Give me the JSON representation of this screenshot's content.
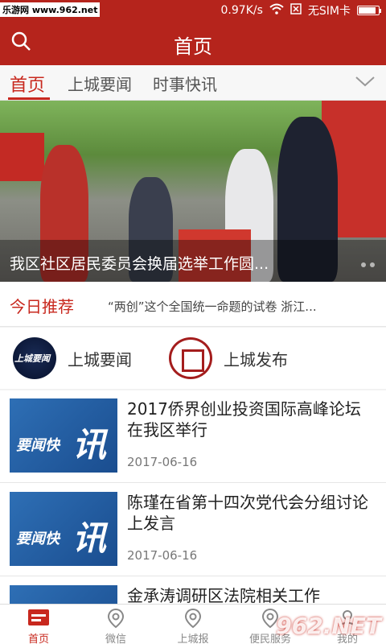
{
  "status_bar": {
    "watermark": "乐游网 www.962.net",
    "speed": "0.97K/s",
    "sim": "无SIM卡"
  },
  "app_bar": {
    "title": "首页"
  },
  "tabs": [
    {
      "label": "首页"
    },
    {
      "label": "上城要闻"
    },
    {
      "label": "时事快讯"
    }
  ],
  "banner": {
    "caption": "我区社区居民委员会换届选举工作圆..."
  },
  "recommend": {
    "label": "今日推荐",
    "text": "“两创”这个全国统一命题的试卷 浙江..."
  },
  "channels": [
    {
      "name": "上城要闻",
      "logo_text": "上城要闻"
    },
    {
      "name": "上城发布"
    }
  ],
  "news": [
    {
      "headline": "2017侨界创业投资国际高峰论坛在我区举行",
      "date": "2017-06-16",
      "thumb_text1": "要闻快",
      "thumb_text2": "讯"
    },
    {
      "headline": "陈瑾在省第十四次党代会分组讨论上发言",
      "date": "2017-06-16",
      "thumb_text1": "要闻快",
      "thumb_text2": "讯"
    },
    {
      "headline": "金承涛调研区法院相关工作",
      "date": "",
      "thumb_text1": "",
      "thumb_text2": ""
    }
  ],
  "bottom_nav": [
    {
      "label": "首页",
      "icon": "home-icon"
    },
    {
      "label": "微信",
      "icon": "location-pin-icon"
    },
    {
      "label": "上城报",
      "icon": "location-pin-icon"
    },
    {
      "label": "便民服务",
      "icon": "location-pin-icon"
    },
    {
      "label": "我的",
      "icon": "user-icon"
    }
  ],
  "watermark_logo": "962.NET",
  "colors": {
    "brand": "#b5241c",
    "accent": "#c8281e"
  }
}
